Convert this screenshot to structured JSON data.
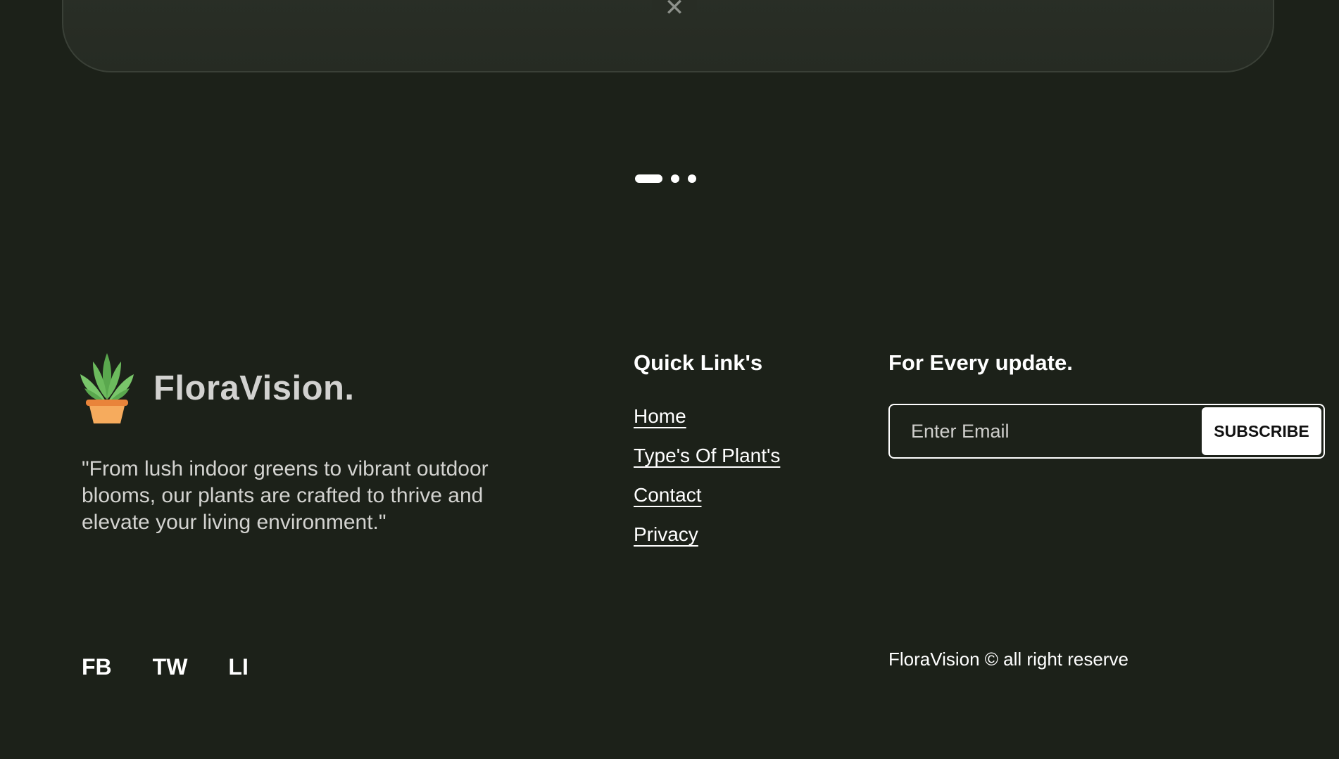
{
  "modal": {
    "close_glyph": "✕"
  },
  "carousel": {
    "dots": [
      {
        "active": true
      },
      {
        "active": false
      },
      {
        "active": false
      }
    ]
  },
  "brand": {
    "name": "FloraVision.",
    "tagline": "\"From lush indoor greens to vibrant outdoor blooms, our plants are crafted to thrive and elevate your living environment.\"",
    "logo_icon": "potted-plant-icon"
  },
  "quick_links": {
    "title": "Quick Link's",
    "items": [
      {
        "label": "Home"
      },
      {
        "label": "Type's Of Plant's"
      },
      {
        "label": "Contact"
      },
      {
        "label": "Privacy"
      }
    ]
  },
  "newsletter": {
    "title": "For Every update.",
    "placeholder": "Enter Email",
    "button_label": "SUBSCRIBE"
  },
  "socials": [
    {
      "label": "FB"
    },
    {
      "label": "TW"
    },
    {
      "label": "LI"
    }
  ],
  "copyright": "FloraVision © all right reserve",
  "colors": {
    "background": "#1c2119",
    "card": "#2a2f27",
    "text": "#ffffff",
    "muted_text": "#d3d3d0"
  }
}
